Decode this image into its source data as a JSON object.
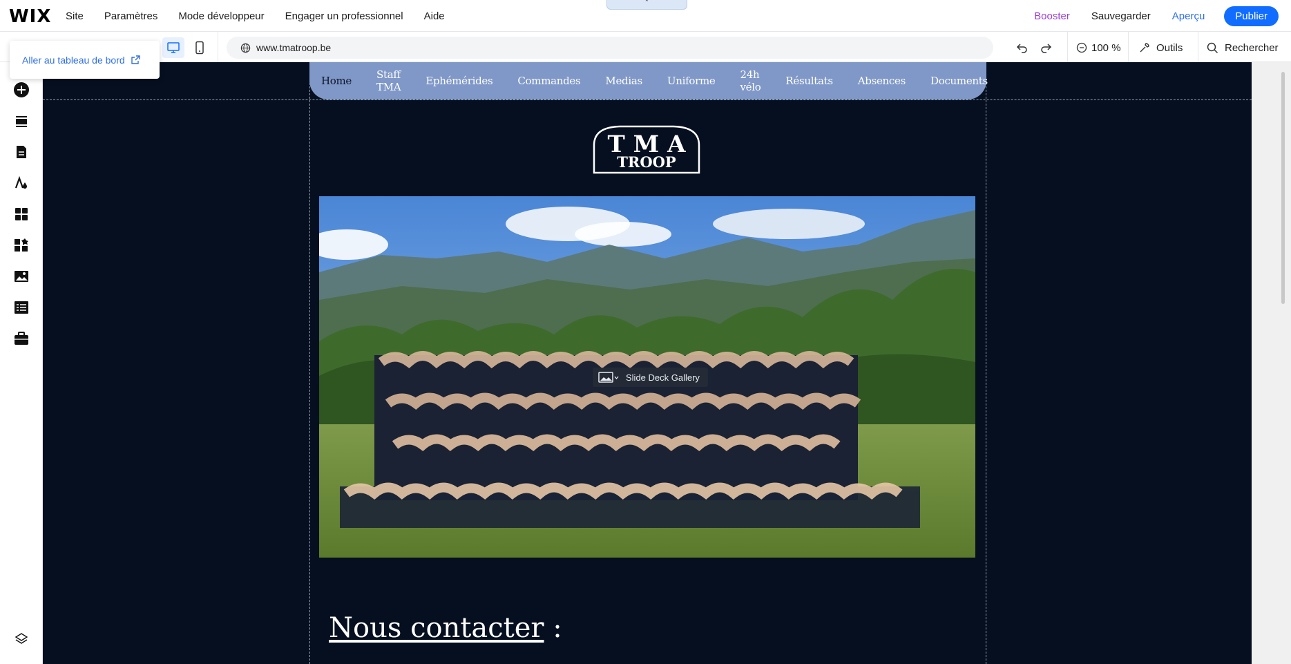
{
  "app": {
    "logo": "WIX"
  },
  "top_menu": {
    "items": [
      "Site",
      "Paramètres",
      "Mode développeur",
      "Engager un professionnel",
      "Aide"
    ]
  },
  "top_actions": {
    "booster": "Booster",
    "save": "Sauvegarder",
    "preview": "Aperçu",
    "publish": "Publier"
  },
  "toolbar": {
    "url": "www.tmatroop.be",
    "zoom": "100 %",
    "tools": "Outils",
    "search": "Rechercher"
  },
  "dashboard_popup": {
    "label": "Aller au tableau de bord"
  },
  "site": {
    "menu": [
      "Home",
      "Staff TMA",
      "Ephémérides",
      "Commandes",
      "Medias",
      "Uniforme",
      "24h vélo",
      "Résultats",
      "Absences",
      "Documents"
    ],
    "logo_line1": "T M A",
    "logo_line2": "TROOP",
    "gallery_label": "Slide Deck Gallery",
    "contact_heading": "Nous contacter",
    "contact_suffix": " :"
  },
  "colors": {
    "canvas_bg": "#050f1f",
    "menu_bg": "#7f98c7",
    "publish": "#116dff",
    "booster": "#9a3fd1",
    "link": "#2f6fe4"
  },
  "icons": {
    "sidebar": [
      "add-icon",
      "sections-icon",
      "pages-icon",
      "design-icon",
      "apps-icon",
      "business-icon",
      "media-icon",
      "cms-icon",
      "portfolio-icon",
      "layers-icon"
    ]
  }
}
